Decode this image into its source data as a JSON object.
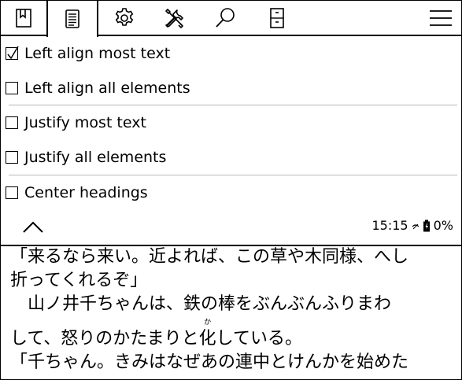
{
  "toolbar": {
    "tabs": [
      {
        "name": "bookmark-icon"
      },
      {
        "name": "document-settings-icon"
      },
      {
        "name": "gear-icon"
      },
      {
        "name": "tools-icon"
      },
      {
        "name": "search-icon"
      },
      {
        "name": "file-cabinet-icon"
      },
      {
        "name": "hamburger-menu-icon"
      }
    ],
    "active_tab": 1
  },
  "menu": {
    "items": [
      {
        "label": "Left align most text",
        "checked": true
      },
      {
        "label": "Left align all elements",
        "checked": false
      },
      {
        "label": "Justify most text",
        "checked": false
      },
      {
        "label": "Justify all elements",
        "checked": false
      },
      {
        "label": "Center headings",
        "checked": false
      }
    ]
  },
  "status": {
    "time": "15:15",
    "battery": "0%"
  },
  "document": {
    "lines": [
      "「来るなら来い。近よれば、この草や木同様、へし",
      "折ってくれるぞ」",
      "　山ノ井千ちゃんは、鉄の棒をぶんぶんふりまわ",
      "して、怒りのかたまりと化している。",
      "「千ちゃん。きみはなぜあの連中とけんかを始めた"
    ],
    "line4_before": "して、怒りのかたまりと",
    "line4_ruby_base": "化",
    "line4_ruby_text": "か",
    "line4_after": "している。"
  },
  "colors": {
    "ink": "#000000",
    "separator": "#b8b8b8",
    "background": "#ffffff"
  }
}
